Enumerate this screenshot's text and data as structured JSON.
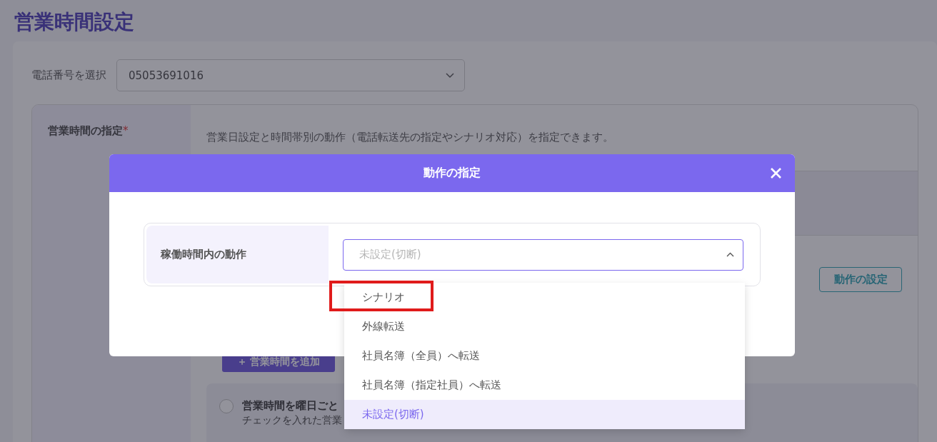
{
  "page": {
    "title": "営業時間設定",
    "phone_label": "電話番号を選択",
    "phone_value": "05053691016"
  },
  "section": {
    "label": "営業時間の指定",
    "required_mark": "*",
    "description": "営業日設定と時間帯別の動作（電話転送先の指定やシナリオ対応）を指定できます。",
    "action_button": "動作の設定",
    "add_button": "＋ 営業時間を追加",
    "weekday_option": {
      "label": "営業時間を曜日ごと",
      "checked": false,
      "note": "チェックを入れた営業"
    }
  },
  "modal": {
    "title": "動作の指定",
    "field_label": "稼働時間内の動作",
    "select_placeholder": "未設定(切断)",
    "expanded": true
  },
  "dropdown": {
    "options": [
      {
        "label": "シナリオ",
        "selected": false,
        "annotated": true
      },
      {
        "label": "外線転送",
        "selected": false,
        "annotated": false
      },
      {
        "label": "社員名簿（全員）へ転送",
        "selected": false,
        "annotated": false
      },
      {
        "label": "社員名簿（指定社員）へ転送",
        "selected": false,
        "annotated": false
      },
      {
        "label": "未設定(切断)",
        "selected": true,
        "annotated": false
      }
    ]
  }
}
